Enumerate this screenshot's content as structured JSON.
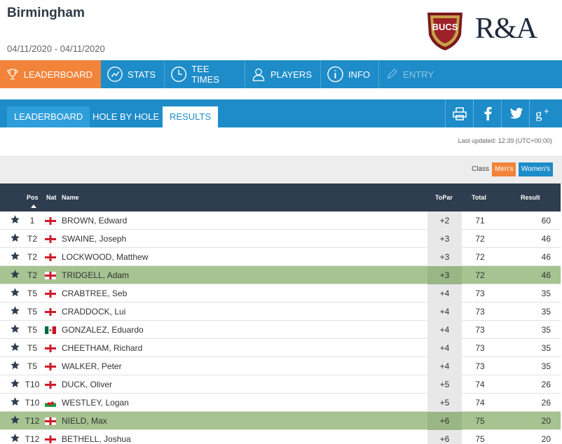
{
  "event": {
    "title": "Birmingham",
    "dates": "04/11/2020 - 04/11/2020",
    "logo_bucs_text": "BUCS",
    "logo_ra_text": "R&A"
  },
  "main_nav": [
    {
      "label": "LEADERBOARD",
      "icon": "trophy-icon",
      "active": true
    },
    {
      "label": "STATS",
      "icon": "chart-icon"
    },
    {
      "label": "TEE TIMES",
      "icon": "clock-icon"
    },
    {
      "label": "PLAYERS",
      "icon": "player-icon"
    },
    {
      "label": "INFO",
      "icon": "info-icon"
    },
    {
      "label": "ENTRY",
      "icon": "pen-icon",
      "disabled": true
    }
  ],
  "sub_nav": {
    "tabs": [
      "LEADERBOARD",
      "HOLE BY HOLE",
      "RESULTS"
    ],
    "active_tab": "RESULTS",
    "share_icons": [
      "print-icon",
      "facebook-icon",
      "twitter-icon",
      "google-plus-icon"
    ]
  },
  "last_updated": "Last updated: 12:39 (UTC+00:00)",
  "class_filter": {
    "label": "Class",
    "men": "Men's",
    "women": "Women's",
    "selected": "Men's"
  },
  "table": {
    "headers": {
      "pos": "Pos",
      "nat": "Nat",
      "name": "Name",
      "topar": "ToPar",
      "total": "Total",
      "result": "Result"
    },
    "rows": [
      {
        "pos": "1",
        "nat": "england",
        "name": "BROWN, Edward",
        "topar": "+2",
        "total": "71",
        "result": "60",
        "highlight": false
      },
      {
        "pos": "T2",
        "nat": "england",
        "name": "SWAINE, Joseph",
        "topar": "+3",
        "total": "72",
        "result": "46",
        "highlight": false
      },
      {
        "pos": "T2",
        "nat": "england",
        "name": "LOCKWOOD, Matthew",
        "topar": "+3",
        "total": "72",
        "result": "46",
        "highlight": false
      },
      {
        "pos": "T2",
        "nat": "england",
        "name": "TRIDGELL, Adam",
        "topar": "+3",
        "total": "72",
        "result": "46",
        "highlight": true
      },
      {
        "pos": "T5",
        "nat": "england",
        "name": "CRABTREE, Seb",
        "topar": "+4",
        "total": "73",
        "result": "35",
        "highlight": false
      },
      {
        "pos": "T5",
        "nat": "england",
        "name": "CRADDOCK, Lui",
        "topar": "+4",
        "total": "73",
        "result": "35",
        "highlight": false
      },
      {
        "pos": "T5",
        "nat": "mexico",
        "name": "GONZALEZ, Eduardo",
        "topar": "+4",
        "total": "73",
        "result": "35",
        "highlight": false
      },
      {
        "pos": "T5",
        "nat": "england",
        "name": "CHEETHAM, Richard",
        "topar": "+4",
        "total": "73",
        "result": "35",
        "highlight": false
      },
      {
        "pos": "T5",
        "nat": "england",
        "name": "WALKER, Peter",
        "topar": "+4",
        "total": "73",
        "result": "35",
        "highlight": false
      },
      {
        "pos": "T10",
        "nat": "england",
        "name": "DUCK, Oliver",
        "topar": "+5",
        "total": "74",
        "result": "26",
        "highlight": false
      },
      {
        "pos": "T10",
        "nat": "wales",
        "name": "WESTLEY, Logan",
        "topar": "+5",
        "total": "74",
        "result": "26",
        "highlight": false
      },
      {
        "pos": "T12",
        "nat": "england",
        "name": "NIELD, Max",
        "topar": "+6",
        "total": "75",
        "result": "20",
        "highlight": true
      },
      {
        "pos": "T12",
        "nat": "england",
        "name": "BETHELL, Joshua",
        "topar": "+6",
        "total": "75",
        "result": "20",
        "highlight": false
      }
    ]
  },
  "colors": {
    "accent_orange": "#f2843a",
    "nav_blue": "#1e8cc8",
    "header_dark": "#2e3d4f",
    "highlight_green": "#a6c391"
  }
}
